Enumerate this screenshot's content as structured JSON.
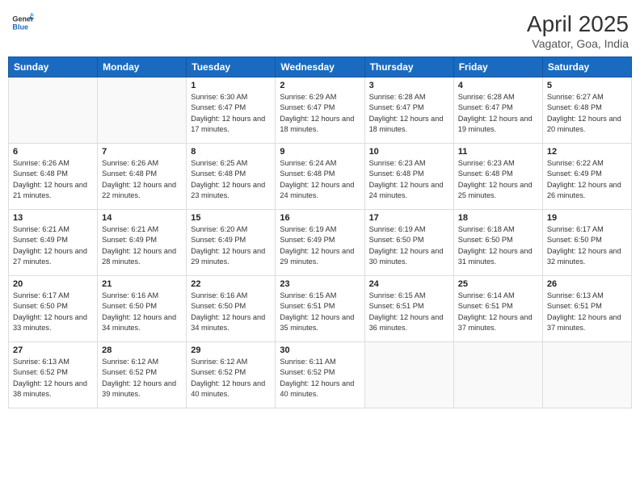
{
  "header": {
    "logo_general": "General",
    "logo_blue": "Blue",
    "month_title": "April 2025",
    "location": "Vagator, Goa, India"
  },
  "days_of_week": [
    "Sunday",
    "Monday",
    "Tuesday",
    "Wednesday",
    "Thursday",
    "Friday",
    "Saturday"
  ],
  "weeks": [
    [
      {
        "day": "",
        "info": ""
      },
      {
        "day": "",
        "info": ""
      },
      {
        "day": "1",
        "info": "Sunrise: 6:30 AM\nSunset: 6:47 PM\nDaylight: 12 hours and 17 minutes."
      },
      {
        "day": "2",
        "info": "Sunrise: 6:29 AM\nSunset: 6:47 PM\nDaylight: 12 hours and 18 minutes."
      },
      {
        "day": "3",
        "info": "Sunrise: 6:28 AM\nSunset: 6:47 PM\nDaylight: 12 hours and 18 minutes."
      },
      {
        "day": "4",
        "info": "Sunrise: 6:28 AM\nSunset: 6:47 PM\nDaylight: 12 hours and 19 minutes."
      },
      {
        "day": "5",
        "info": "Sunrise: 6:27 AM\nSunset: 6:48 PM\nDaylight: 12 hours and 20 minutes."
      }
    ],
    [
      {
        "day": "6",
        "info": "Sunrise: 6:26 AM\nSunset: 6:48 PM\nDaylight: 12 hours and 21 minutes."
      },
      {
        "day": "7",
        "info": "Sunrise: 6:26 AM\nSunset: 6:48 PM\nDaylight: 12 hours and 22 minutes."
      },
      {
        "day": "8",
        "info": "Sunrise: 6:25 AM\nSunset: 6:48 PM\nDaylight: 12 hours and 23 minutes."
      },
      {
        "day": "9",
        "info": "Sunrise: 6:24 AM\nSunset: 6:48 PM\nDaylight: 12 hours and 24 minutes."
      },
      {
        "day": "10",
        "info": "Sunrise: 6:23 AM\nSunset: 6:48 PM\nDaylight: 12 hours and 24 minutes."
      },
      {
        "day": "11",
        "info": "Sunrise: 6:23 AM\nSunset: 6:48 PM\nDaylight: 12 hours and 25 minutes."
      },
      {
        "day": "12",
        "info": "Sunrise: 6:22 AM\nSunset: 6:49 PM\nDaylight: 12 hours and 26 minutes."
      }
    ],
    [
      {
        "day": "13",
        "info": "Sunrise: 6:21 AM\nSunset: 6:49 PM\nDaylight: 12 hours and 27 minutes."
      },
      {
        "day": "14",
        "info": "Sunrise: 6:21 AM\nSunset: 6:49 PM\nDaylight: 12 hours and 28 minutes."
      },
      {
        "day": "15",
        "info": "Sunrise: 6:20 AM\nSunset: 6:49 PM\nDaylight: 12 hours and 29 minutes."
      },
      {
        "day": "16",
        "info": "Sunrise: 6:19 AM\nSunset: 6:49 PM\nDaylight: 12 hours and 29 minutes."
      },
      {
        "day": "17",
        "info": "Sunrise: 6:19 AM\nSunset: 6:50 PM\nDaylight: 12 hours and 30 minutes."
      },
      {
        "day": "18",
        "info": "Sunrise: 6:18 AM\nSunset: 6:50 PM\nDaylight: 12 hours and 31 minutes."
      },
      {
        "day": "19",
        "info": "Sunrise: 6:17 AM\nSunset: 6:50 PM\nDaylight: 12 hours and 32 minutes."
      }
    ],
    [
      {
        "day": "20",
        "info": "Sunrise: 6:17 AM\nSunset: 6:50 PM\nDaylight: 12 hours and 33 minutes."
      },
      {
        "day": "21",
        "info": "Sunrise: 6:16 AM\nSunset: 6:50 PM\nDaylight: 12 hours and 34 minutes."
      },
      {
        "day": "22",
        "info": "Sunrise: 6:16 AM\nSunset: 6:50 PM\nDaylight: 12 hours and 34 minutes."
      },
      {
        "day": "23",
        "info": "Sunrise: 6:15 AM\nSunset: 6:51 PM\nDaylight: 12 hours and 35 minutes."
      },
      {
        "day": "24",
        "info": "Sunrise: 6:15 AM\nSunset: 6:51 PM\nDaylight: 12 hours and 36 minutes."
      },
      {
        "day": "25",
        "info": "Sunrise: 6:14 AM\nSunset: 6:51 PM\nDaylight: 12 hours and 37 minutes."
      },
      {
        "day": "26",
        "info": "Sunrise: 6:13 AM\nSunset: 6:51 PM\nDaylight: 12 hours and 37 minutes."
      }
    ],
    [
      {
        "day": "27",
        "info": "Sunrise: 6:13 AM\nSunset: 6:52 PM\nDaylight: 12 hours and 38 minutes."
      },
      {
        "day": "28",
        "info": "Sunrise: 6:12 AM\nSunset: 6:52 PM\nDaylight: 12 hours and 39 minutes."
      },
      {
        "day": "29",
        "info": "Sunrise: 6:12 AM\nSunset: 6:52 PM\nDaylight: 12 hours and 40 minutes."
      },
      {
        "day": "30",
        "info": "Sunrise: 6:11 AM\nSunset: 6:52 PM\nDaylight: 12 hours and 40 minutes."
      },
      {
        "day": "",
        "info": ""
      },
      {
        "day": "",
        "info": ""
      },
      {
        "day": "",
        "info": ""
      }
    ]
  ]
}
